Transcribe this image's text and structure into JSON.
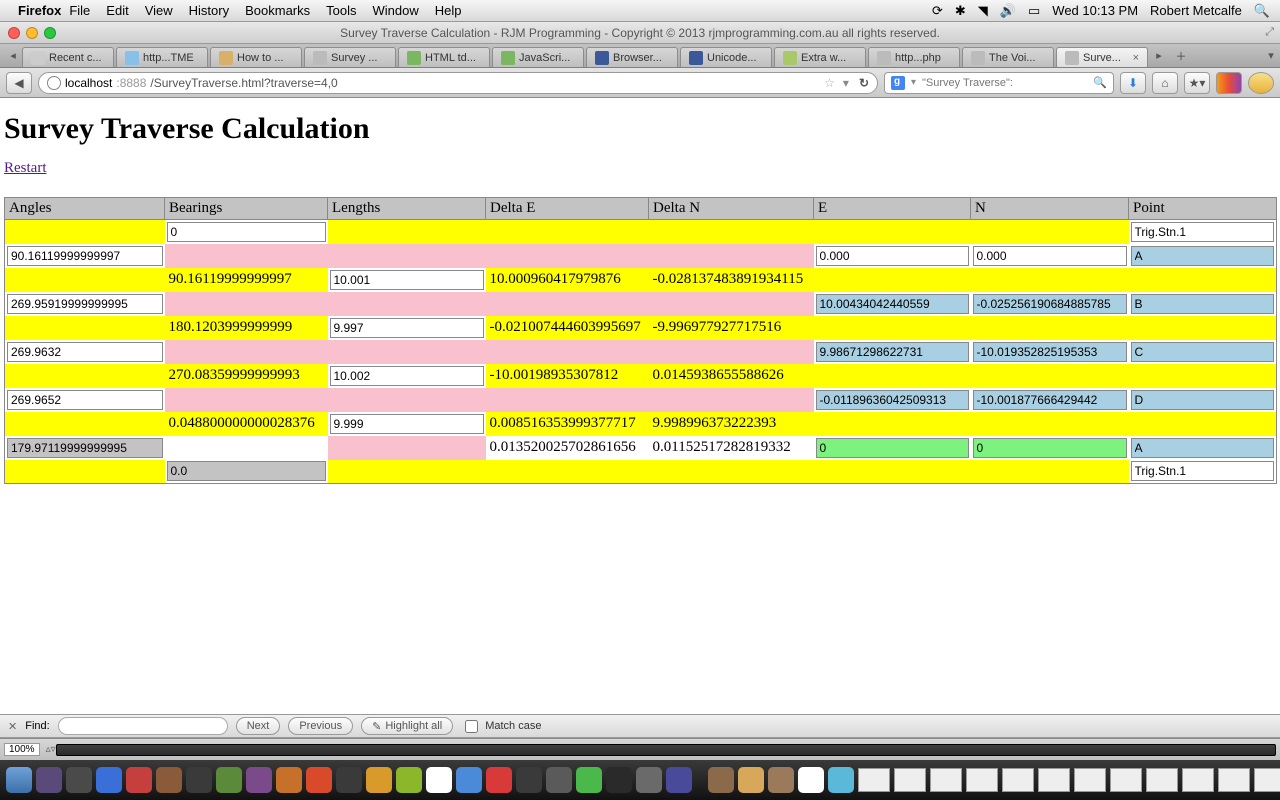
{
  "menubar": {
    "app": "Firefox",
    "items": [
      "File",
      "Edit",
      "View",
      "History",
      "Bookmarks",
      "Tools",
      "Window",
      "Help"
    ],
    "clock": "Wed 10:13 PM",
    "user": "Robert Metcalfe"
  },
  "window": {
    "title": "Survey Traverse Calculation - RJM Programming - Copyright © 2013 rjmprogramming.com.au all rights reserved."
  },
  "tabs": [
    {
      "label": "Recent c...",
      "color": "#ccc"
    },
    {
      "label": "http...TME",
      "color": "#87c0e8"
    },
    {
      "label": "How to ...",
      "color": "#d8b06a"
    },
    {
      "label": "Survey ...",
      "color": "#bbb"
    },
    {
      "label": "HTML td...",
      "color": "#7bb661"
    },
    {
      "label": "JavaScri...",
      "color": "#7bb661"
    },
    {
      "label": "Browser...",
      "color": "#3b5998"
    },
    {
      "label": "Unicode...",
      "color": "#3b5998"
    },
    {
      "label": "Extra w...",
      "color": "#a8c96a"
    },
    {
      "label": "http...php",
      "color": "#bbb"
    },
    {
      "label": "The Voi...",
      "color": "#bbb"
    },
    {
      "label": "Surve...",
      "color": "#bbb",
      "active": true
    }
  ],
  "url": {
    "host": "localhost",
    "port": ":8888",
    "path": "/SurveyTraverse.html?traverse=4,0"
  },
  "search": {
    "placeholder": "\"Survey Traverse\":"
  },
  "page": {
    "heading": "Survey Traverse Calculation",
    "restart": "Restart"
  },
  "headers": [
    "Angles",
    "Bearings",
    "Lengths",
    "Delta E",
    "Delta N",
    "E",
    "N",
    "Point"
  ],
  "row1": {
    "bearing": "0",
    "point": "Trig.Stn.1"
  },
  "row2": {
    "angle": "90.16119999999997",
    "e": "0.000",
    "n": "0.000",
    "point": "A"
  },
  "row3": {
    "bearing": "90.16119999999997",
    "length": "10.001",
    "de": "10.000960417979876",
    "dn": "-0.028137483891934115"
  },
  "row4": {
    "angle": "269.95919999999995",
    "e": "10.00434042440559",
    "n": "-0.025256190684885785",
    "point": "B"
  },
  "row5": {
    "bearing": "180.1203999999999",
    "length": "9.997",
    "de": "-0.021007444603995697",
    "dn": "-9.996977927717516"
  },
  "row6": {
    "angle": "269.9632",
    "e": "9.98671298622731",
    "n": "-10.019352825195353",
    "point": "C"
  },
  "row7": {
    "bearing": "270.08359999999993",
    "length": "10.002",
    "de": "-10.0019893530781​2",
    "dn": "0.0145938655588626"
  },
  "row8": {
    "angle": "269.9652",
    "e": "-0.01189636042509313",
    "n": "-10.001877666429442",
    "point": "D"
  },
  "row9": {
    "bearing": "0.048800000000028376",
    "length": "9.999",
    "de": "0.008516353999377717",
    "dn": "9.998996373222393"
  },
  "row10": {
    "angle": "179.97119999999995",
    "de": "0.013520025702861656",
    "dn": "0.01152517282819332",
    "e": "0",
    "n": "0",
    "point": "A"
  },
  "row11": {
    "bearing": "0.0",
    "point": "Trig.Stn.1"
  },
  "findbar": {
    "label": "Find:",
    "next": "Next",
    "prev": "Previous",
    "hl": "Highlight all",
    "match": "Match case"
  },
  "status": {
    "zoom": "100%"
  }
}
